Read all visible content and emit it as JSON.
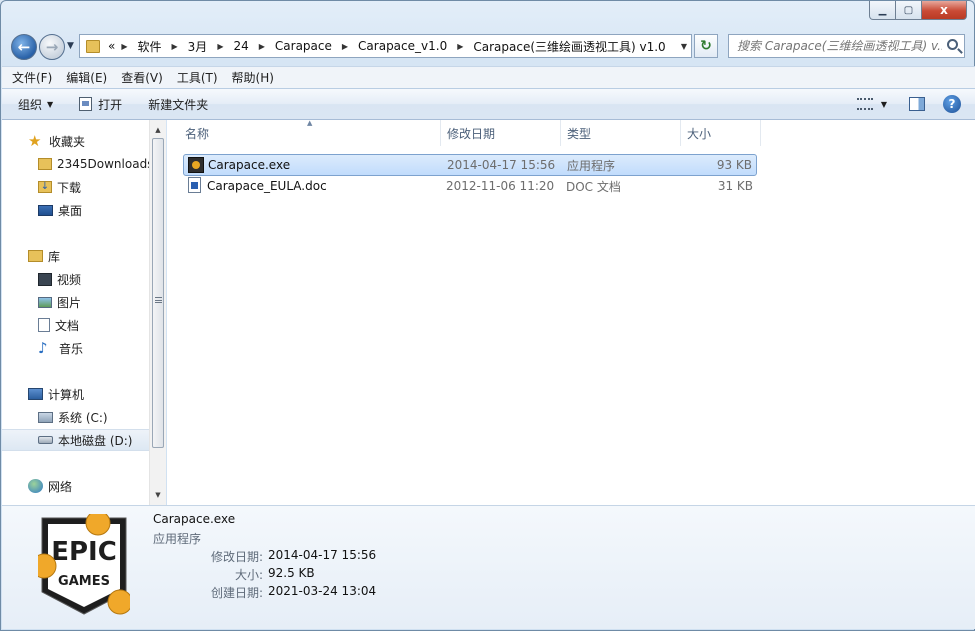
{
  "window": {
    "caption": {
      "minimize_icon": "minimize-icon",
      "maximize_icon": "maximize-icon",
      "close_icon": "close-icon",
      "close_glyph": "x"
    }
  },
  "address_bar": {
    "overflow": "«",
    "path": [
      "软件",
      "3月",
      "24",
      "Carapace",
      "Carapace_v1.0",
      "Carapace(三维绘画透视工具) v1.0"
    ]
  },
  "search": {
    "placeholder": "搜索 Carapace(三维绘画透视工具) v..."
  },
  "menu": [
    "文件(F)",
    "编辑(E)",
    "查看(V)",
    "工具(T)",
    "帮助(H)"
  ],
  "commands": {
    "organize": "组织",
    "open": "打开",
    "new_folder": "新建文件夹"
  },
  "nav": {
    "favorites": "收藏夹",
    "fav_items": [
      "2345Downloads",
      "下载",
      "桌面"
    ],
    "libraries": "库",
    "lib_items": [
      "视频",
      "图片",
      "文档",
      "音乐"
    ],
    "computer": "计算机",
    "drives": [
      "系统 (C:)",
      "本地磁盘 (D:)"
    ],
    "network": "网络"
  },
  "columns": {
    "name": "名称",
    "date": "修改日期",
    "type": "类型",
    "size": "大小"
  },
  "files": [
    {
      "name": "Carapace.exe",
      "date": "2014-04-17 15:56",
      "type": "应用程序",
      "size": "93 KB"
    },
    {
      "name": "Carapace_EULA.doc",
      "date": "2012-11-06 11:20",
      "type": "DOC 文档",
      "size": "31 KB"
    }
  ],
  "details": {
    "name": "Carapace.exe",
    "type": "应用程序",
    "modified_label": "修改日期:",
    "modified_value": "2014-04-17 15:56",
    "size_label": "大小:",
    "size_value": "92.5 KB",
    "created_label": "创建日期:",
    "created_value": "2021-03-24 13:04",
    "logo_text_top": "EPIC",
    "logo_text_bottom": "GAMES"
  },
  "colors": {
    "accent": "#3a6ea5",
    "selection": "#c1dcfc",
    "logo_dot": "#f0a82a"
  }
}
